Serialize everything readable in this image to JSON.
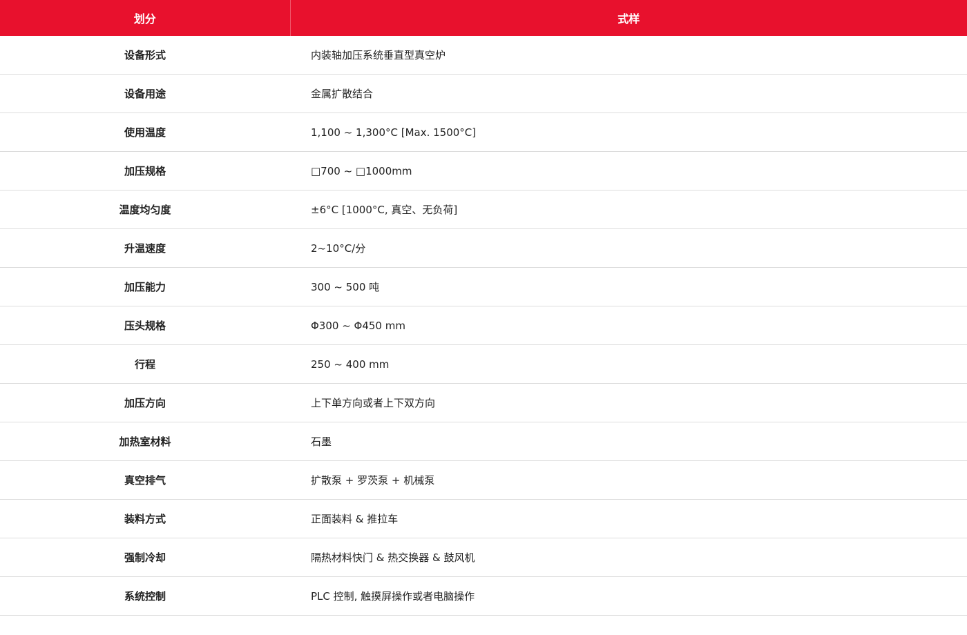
{
  "header": {
    "col1": "划分",
    "col2": "式样"
  },
  "rows": [
    {
      "label": "设备形式",
      "value": "内装轴加压系统垂直型真空炉"
    },
    {
      "label": "设备用途",
      "value": "金属扩散结合"
    },
    {
      "label": "使用温度",
      "value": "1,100 ~ 1,300°C [Max. 1500°C]"
    },
    {
      "label": "加压规格",
      "value": "□700 ~ □1000mm"
    },
    {
      "label": "温度均匀度",
      "value": "±6°C [1000°C, 真空、无负荷]"
    },
    {
      "label": "升温速度",
      "value": "2~10°C/分"
    },
    {
      "label": "加压能力",
      "value": "300 ~ 500 吨"
    },
    {
      "label": "压头规格",
      "value": "Φ300 ~ Φ450 mm"
    },
    {
      "label": "行程",
      "value": "250 ~ 400 mm"
    },
    {
      "label": "加压方向",
      "value": "上下单方向或者上下双方向"
    },
    {
      "label": "加热室材料",
      "value": "石墨"
    },
    {
      "label": "真空排气",
      "value": "扩散泵 + 罗茨泵 + 机械泵"
    },
    {
      "label": "装料方式",
      "value": "正面装料 & 推拉车"
    },
    {
      "label": "强制冷却",
      "value": "隔热材料快门 & 热交换器 & 鼓风机"
    },
    {
      "label": "系统控制",
      "value": "PLC 控制, 触摸屏操作或者电脑操作"
    }
  ],
  "colors": {
    "header_bg": "#e8112d",
    "header_text": "#ffffff",
    "row_border": "#dcdcdc"
  }
}
